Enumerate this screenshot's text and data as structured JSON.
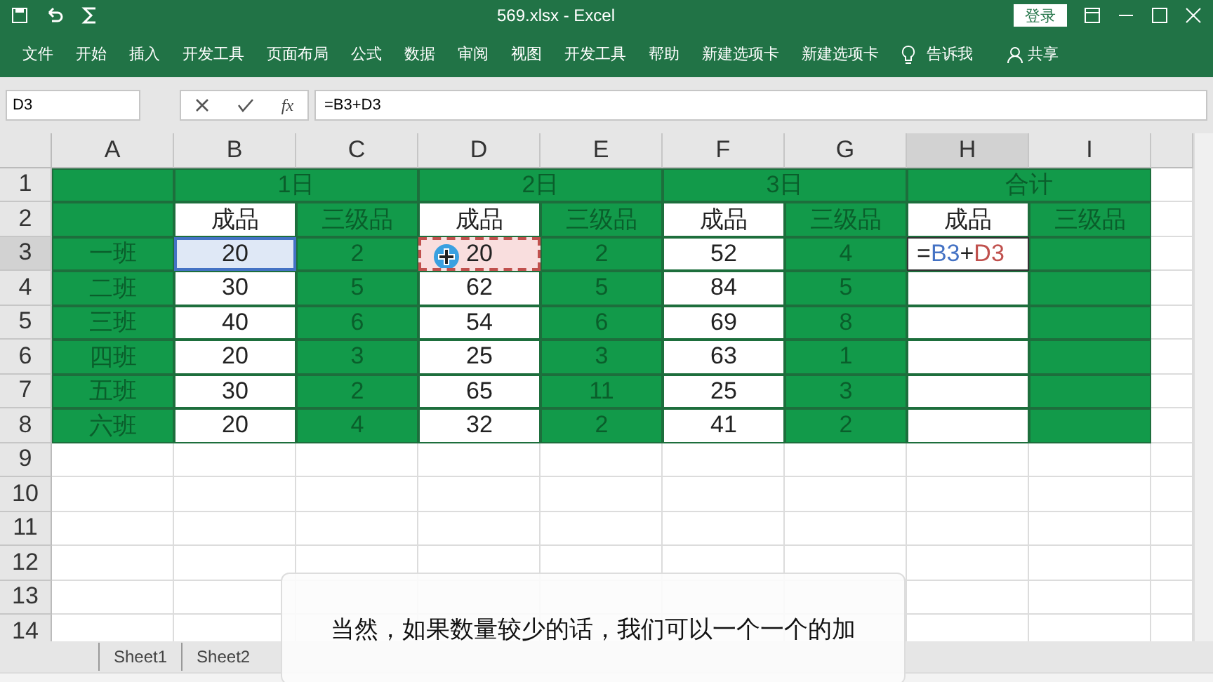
{
  "window": {
    "title": "569.xlsx  -  Excel",
    "login": "登录"
  },
  "ribbon": {
    "tabs": [
      "文件",
      "开始",
      "插入",
      "开发工具",
      "页面布局",
      "公式",
      "数据",
      "审阅",
      "视图",
      "开发工具",
      "帮助",
      "新建选项卡",
      "新建选项卡"
    ],
    "tell_me": "告诉我",
    "share": "共享"
  },
  "formula_bar": {
    "name_box": "D3",
    "fx": "fx",
    "formula": "=B3+D3"
  },
  "sheet": {
    "columns": [
      {
        "label": "A",
        "selected": false
      },
      {
        "label": "B",
        "selected": false
      },
      {
        "label": "C",
        "selected": false
      },
      {
        "label": "D",
        "selected": false
      },
      {
        "label": "E",
        "selected": false
      },
      {
        "label": "F",
        "selected": false
      },
      {
        "label": "G",
        "selected": false
      },
      {
        "label": "H",
        "selected": true
      },
      {
        "label": "I",
        "selected": false
      }
    ],
    "rows": [
      {
        "label": "1",
        "selected": false,
        "cells": [
          {
            "kind": "green",
            "text": ""
          },
          {
            "kind": "merged",
            "text": "1日"
          },
          {
            "kind": "merged",
            "text": "2日"
          },
          {
            "kind": "merged",
            "text": "3日"
          },
          {
            "kind": "merged",
            "text": "合计"
          }
        ]
      },
      {
        "label": "2",
        "selected": false,
        "cells": [
          {
            "kind": "green",
            "text": ""
          },
          {
            "kind": "white",
            "text": "成品"
          },
          {
            "kind": "green",
            "text": "三级品"
          },
          {
            "kind": "white",
            "text": "成品"
          },
          {
            "kind": "green",
            "text": "三级品"
          },
          {
            "kind": "white",
            "text": "成品"
          },
          {
            "kind": "green",
            "text": "三级品"
          },
          {
            "kind": "white",
            "text": "成品"
          },
          {
            "kind": "green",
            "text": "三级品"
          }
        ]
      },
      {
        "label": "3",
        "selected": true,
        "cells": [
          {
            "kind": "green",
            "text": "一班"
          },
          {
            "kind": "ref",
            "color": "#4472c4",
            "text": "20"
          },
          {
            "kind": "green",
            "text": "2"
          },
          {
            "kind": "ref",
            "color": "#c0504d",
            "text": "20"
          },
          {
            "kind": "green",
            "text": "2"
          },
          {
            "kind": "white",
            "text": "52"
          },
          {
            "kind": "green",
            "text": "4"
          },
          {
            "kind": "edit",
            "parts": [
              {
                "text": "=",
                "color": "#222222"
              },
              {
                "text": "B3",
                "color": "#4472c4"
              },
              {
                "text": "+",
                "color": "#222222"
              },
              {
                "text": "D3",
                "color": "#c0504d"
              }
            ]
          },
          {
            "kind": "green",
            "text": ""
          }
        ]
      },
      {
        "label": "4",
        "selected": false,
        "cells": [
          {
            "kind": "green",
            "text": "二班"
          },
          {
            "kind": "white",
            "text": "30"
          },
          {
            "kind": "green",
            "text": "5"
          },
          {
            "kind": "white",
            "text": "62"
          },
          {
            "kind": "green",
            "text": "5"
          },
          {
            "kind": "white",
            "text": "84"
          },
          {
            "kind": "green",
            "text": "5"
          },
          {
            "kind": "white",
            "text": ""
          },
          {
            "kind": "green",
            "text": ""
          }
        ]
      },
      {
        "label": "5",
        "selected": false,
        "cells": [
          {
            "kind": "green",
            "text": "三班"
          },
          {
            "kind": "white",
            "text": "40"
          },
          {
            "kind": "green",
            "text": "6"
          },
          {
            "kind": "white",
            "text": "54"
          },
          {
            "kind": "green",
            "text": "6"
          },
          {
            "kind": "white",
            "text": "69"
          },
          {
            "kind": "green",
            "text": "8"
          },
          {
            "kind": "white",
            "text": ""
          },
          {
            "kind": "green",
            "text": ""
          }
        ]
      },
      {
        "label": "6",
        "selected": false,
        "cells": [
          {
            "kind": "green",
            "text": "四班"
          },
          {
            "kind": "white",
            "text": "20"
          },
          {
            "kind": "green",
            "text": "3"
          },
          {
            "kind": "white",
            "text": "25"
          },
          {
            "kind": "green",
            "text": "3"
          },
          {
            "kind": "white",
            "text": "63"
          },
          {
            "kind": "green",
            "text": "1"
          },
          {
            "kind": "white",
            "text": ""
          },
          {
            "kind": "green",
            "text": ""
          }
        ]
      },
      {
        "label": "7",
        "selected": false,
        "cells": [
          {
            "kind": "green",
            "text": "五班"
          },
          {
            "kind": "white",
            "text": "30"
          },
          {
            "kind": "green",
            "text": "2"
          },
          {
            "kind": "white",
            "text": "65"
          },
          {
            "kind": "green",
            "text": "11"
          },
          {
            "kind": "white",
            "text": "25"
          },
          {
            "kind": "green",
            "text": "3"
          },
          {
            "kind": "white",
            "text": ""
          },
          {
            "kind": "green",
            "text": ""
          }
        ]
      },
      {
        "label": "8",
        "selected": false,
        "cells": [
          {
            "kind": "green",
            "text": "六班"
          },
          {
            "kind": "white",
            "text": "20"
          },
          {
            "kind": "green",
            "text": "4"
          },
          {
            "kind": "white",
            "text": "32"
          },
          {
            "kind": "green",
            "text": "2"
          },
          {
            "kind": "white",
            "text": "41"
          },
          {
            "kind": "green",
            "text": "2"
          },
          {
            "kind": "white",
            "text": ""
          },
          {
            "kind": "green",
            "text": ""
          }
        ]
      },
      {
        "label": "9",
        "selected": false,
        "cells": []
      },
      {
        "label": "10",
        "selected": false,
        "cells": []
      },
      {
        "label": "11",
        "selected": false,
        "cells": []
      },
      {
        "label": "12",
        "selected": false,
        "cells": []
      },
      {
        "label": "13",
        "selected": false,
        "cells": []
      },
      {
        "label": "14",
        "selected": false,
        "cells": []
      }
    ]
  },
  "sheet_tabs": [
    {
      "label": "Sheet1"
    },
    {
      "label": "Sheet2"
    }
  ],
  "subtitle": "当然，如果数量较少的话，我们可以一个一个的加"
}
